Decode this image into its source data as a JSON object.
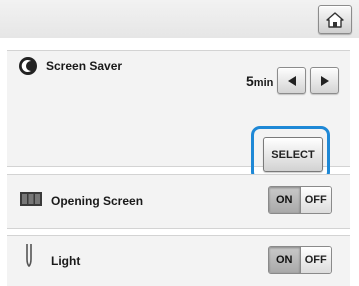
{
  "header": {
    "home_icon": "home-icon"
  },
  "screen_saver": {
    "label": "Screen Saver",
    "icon": "screen-saver-icon",
    "value_number": "5",
    "value_unit": "min",
    "decrease_icon": "arrow-left-icon",
    "increase_icon": "arrow-right-icon",
    "select_label": "SELECT",
    "highlight_color": "#1e88d6"
  },
  "opening_screen": {
    "label": "Opening Screen",
    "icon": "opening-screen-icon",
    "on_label": "ON",
    "off_label": "OFF",
    "state": "ON"
  },
  "light": {
    "label": "Light",
    "icon": "light-icon",
    "on_label": "ON",
    "off_label": "OFF",
    "state": "ON"
  }
}
